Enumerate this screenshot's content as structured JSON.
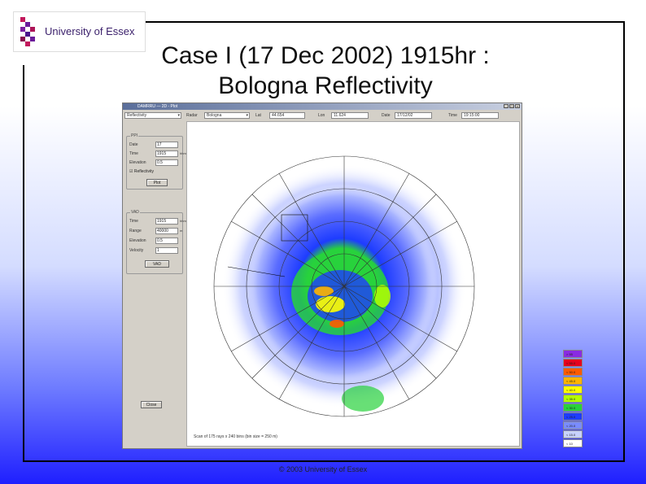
{
  "logo": {
    "text": "University of Essex"
  },
  "slide": {
    "title_line1": "Case I (17 Dec 2002) 1915hr :",
    "title_line2": "Bologna Reflectivity"
  },
  "window": {
    "title": "DAMRRU — 2D - Plot",
    "buttons": [
      "_",
      "□",
      "×"
    ]
  },
  "toolbar": {
    "display_select": "Reflectivity",
    "radar_label": "Radar",
    "radar_value": "Bologna",
    "lat_label": "Lat",
    "lat_value": "44.654",
    "lon_label": "Lon",
    "lon_value": "11.624",
    "date_label": "Date",
    "date_value": "17/12/02",
    "time_label": "Time",
    "time_value": "19:15:00"
  },
  "ppi": {
    "group_title": "PPI",
    "date_label": "Date",
    "date_value": "17",
    "time_label": "Time",
    "time_value": "1915",
    "time_unit": "hhmm",
    "elev_label": "Elevation",
    "elev_value": "0.5",
    "checkbox_label": "Reflectivity",
    "plot_button": "Plot"
  },
  "vad": {
    "group_title": "VAD",
    "time_label": "Time",
    "time_value": "1915",
    "time_unit": "hhmm",
    "range_label": "Range",
    "range_value": "40000",
    "range_unit": "m",
    "elev_label": "Elevation",
    "elev_value": "0.5",
    "vel_label": "Velocity",
    "vel_value": "1",
    "button": "VAD"
  },
  "close_button": "Close",
  "status_text": "Scan of 175 rays x 240 bins (bin size = 250 m)",
  "legend": [
    {
      "label": "> 55",
      "color": "#8a2be2"
    },
    {
      "label": "< 55.0",
      "color": "#e6001e"
    },
    {
      "label": "< 50.0",
      "color": "#ff5a00"
    },
    {
      "label": "< 45.0",
      "color": "#ffb400"
    },
    {
      "label": "< 40.0",
      "color": "#ffff00"
    },
    {
      "label": "< 35.0",
      "color": "#b4ff00"
    },
    {
      "label": "< 30.0",
      "color": "#28d23c"
    },
    {
      "label": "< 25.0",
      "color": "#1e3cff"
    },
    {
      "label": "< 20.0",
      "color": "#7a8cff"
    },
    {
      "label": "< 15.0",
      "color": "#c8d2ff"
    },
    {
      "label": "< 10",
      "color": "#ffffff"
    }
  ],
  "footer": "© 2003 University of Essex"
}
